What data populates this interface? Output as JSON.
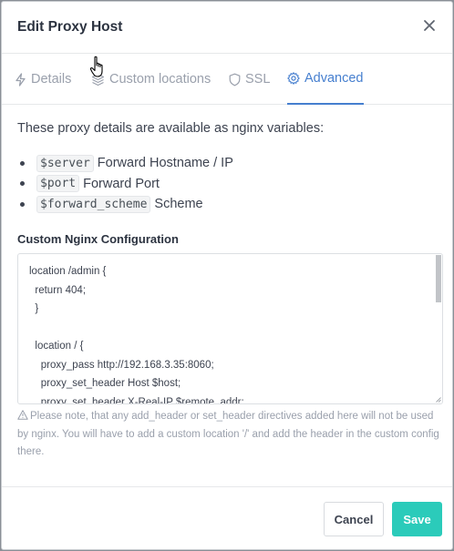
{
  "modal": {
    "title": "Edit Proxy Host",
    "close_icon": "close-icon"
  },
  "tabs": [
    {
      "label": "Details",
      "icon": "bolt-icon",
      "active": false
    },
    {
      "label": "Custom locations",
      "icon": "layers-icon",
      "active": false
    },
    {
      "label": "SSL",
      "icon": "shield-icon",
      "active": false
    },
    {
      "label": "Advanced",
      "icon": "gear-icon",
      "active": true
    }
  ],
  "intro_text": "These proxy details are available as nginx variables:",
  "variables": [
    {
      "code": "$server",
      "desc": "Forward Hostname / IP"
    },
    {
      "code": "$port",
      "desc": "Forward Port"
    },
    {
      "code": "$forward_scheme",
      "desc": "Scheme"
    }
  ],
  "config": {
    "label": "Custom Nginx Configuration",
    "value": "location /admin {\n  return 404;\n  }\n\n  location / {\n    proxy_pass http://192.168.3.35:8060;\n    proxy_set_header Host $host;\n    proxy_set_header X-Real-IP $remote_addr;\n    proxy_set_header X-Forwarded-For $proxy_add_x_forwarded_for;"
  },
  "note": "Please note, that any add_header or set_header directives added here will not be used by nginx. You will have to add a custom location '/' and add the header in the custom config there.",
  "footer": {
    "cancel_label": "Cancel",
    "save_label": "Save"
  },
  "colors": {
    "accent": "#467fcf",
    "save": "#2bcbba"
  }
}
